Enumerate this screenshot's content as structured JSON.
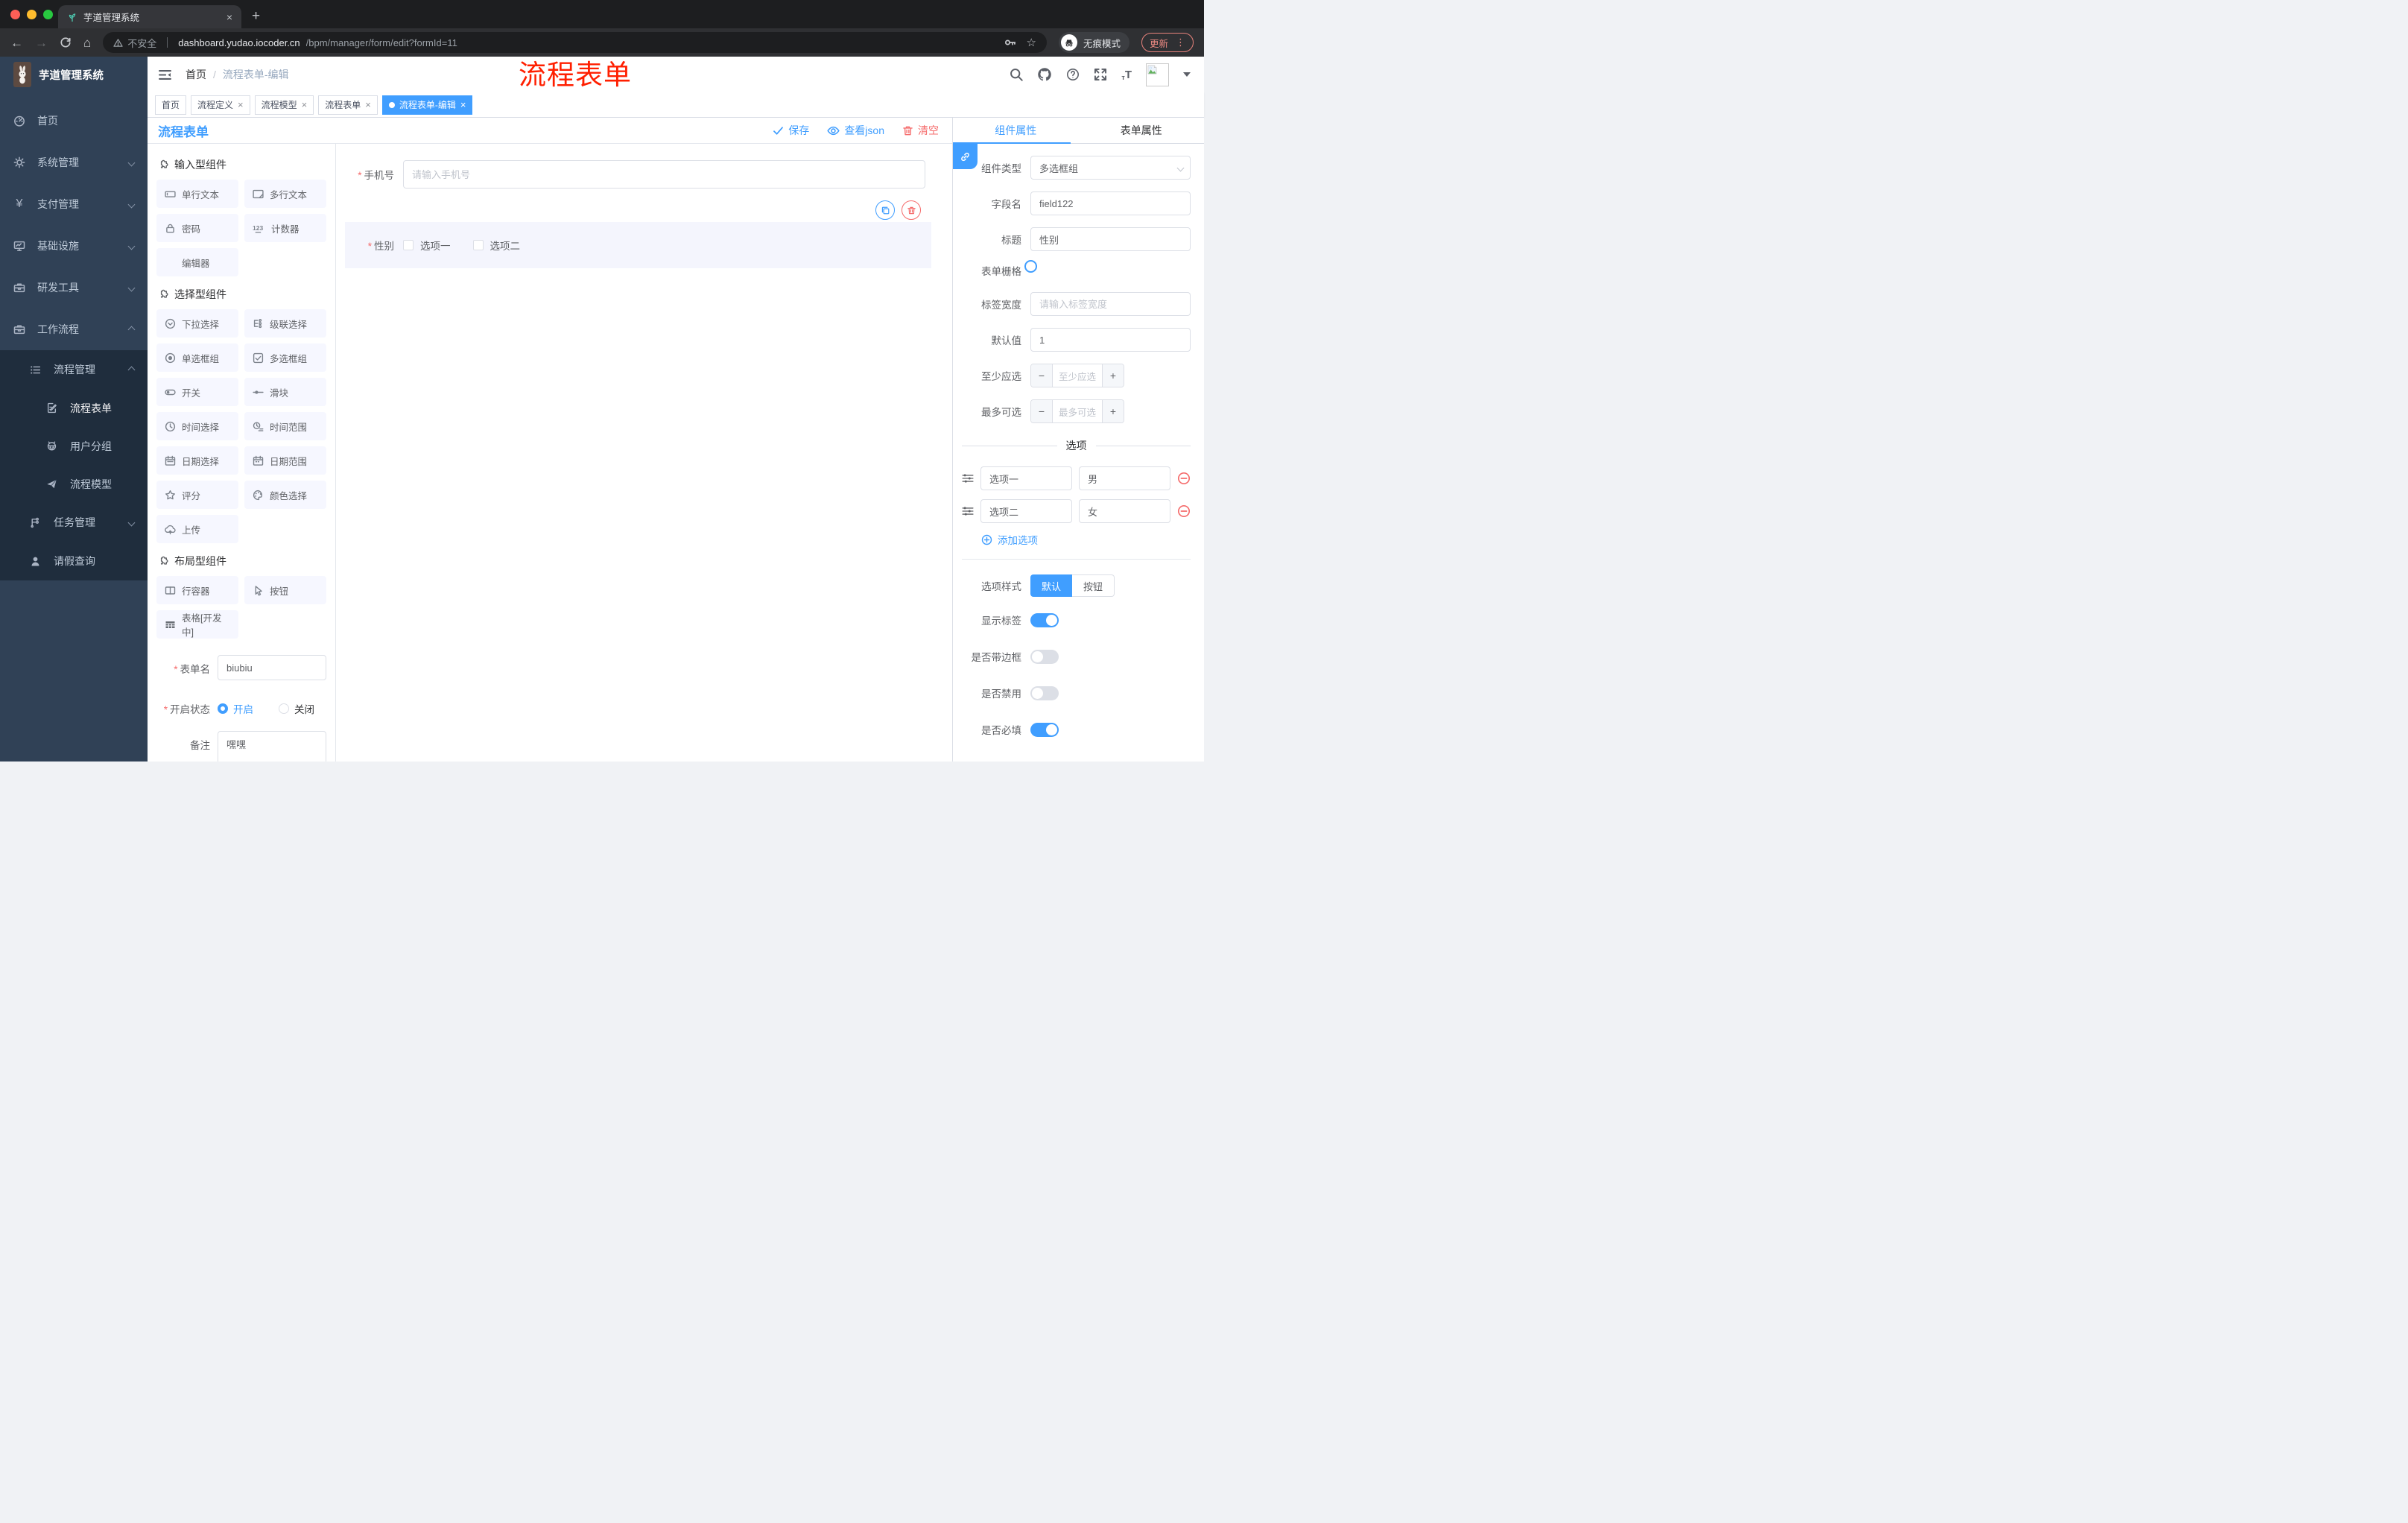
{
  "browser": {
    "tab_title": "芋道管理系统",
    "security": "不安全",
    "host": "dashboard.yudao.iocoder.cn",
    "path": "/bpm/manager/form/edit?formId=11",
    "incognito": "无痕模式",
    "update": "更新"
  },
  "annotation": "流程表单",
  "header": {
    "logo_title": "芋道管理系统",
    "breadcrumb_home": "首页",
    "breadcrumb_current": "流程表单-编辑"
  },
  "sidebar": {
    "home": "首页",
    "system": "系统管理",
    "payment": "支付管理",
    "infrastructure": "基础设施",
    "devtools": "研发工具",
    "workflow": "工作流程",
    "process_management": "流程管理",
    "process_form": "流程表单",
    "user_group": "用户分组",
    "process_model": "流程模型",
    "task_management": "任务管理",
    "leave_query": "请假查询"
  },
  "tags": {
    "home": "首页",
    "process_def": "流程定义",
    "process_model": "流程模型",
    "process_form": "流程表单",
    "active": "流程表单-编辑"
  },
  "designer": {
    "panel_title": "流程表单",
    "toolbar": {
      "save": "保存",
      "view_json": "查看json",
      "clear": "清空"
    },
    "palette": {
      "sections": [
        {
          "title": "输入型组件",
          "items": [
            "单行文本",
            "多行文本",
            "密码",
            "计数器",
            "编辑器"
          ]
        },
        {
          "title": "选择型组件",
          "items": [
            "下拉选择",
            "级联选择",
            "单选框组",
            "多选框组",
            "开关",
            "滑块",
            "时间选择",
            "时间范围",
            "日期选择",
            "日期范围",
            "评分",
            "颜色选择",
            "上传"
          ]
        },
        {
          "title": "布局型组件",
          "items": [
            "行容器",
            "按钮",
            "表格[开发中]"
          ]
        }
      ]
    },
    "meta": {
      "form_name_label": "表单名",
      "form_name_value": "biubiu",
      "status_label": "开启状态",
      "status_on": "开启",
      "status_off": "关闭",
      "remark_label": "备注",
      "remark_value": "嘿嘿"
    },
    "canvas": {
      "phone_label": "手机号",
      "phone_placeholder": "请输入手机号",
      "gender_label": "性别",
      "gender_options": [
        "选项一",
        "选项二"
      ]
    },
    "props": {
      "tab_component": "组件属性",
      "tab_form": "表单属性",
      "component_type_label": "组件类型",
      "component_type_value": "多选框组",
      "field_name_label": "字段名",
      "field_name_value": "field122",
      "title_label": "标题",
      "title_value": "性别",
      "grid_label": "表单栅格",
      "label_width_label": "标签宽度",
      "label_width_placeholder": "请输入标签宽度",
      "default_label": "默认值",
      "default_value": "1",
      "min_label": "至少应选",
      "min_placeholder": "至少应选",
      "max_label": "最多可选",
      "max_placeholder": "最多可选",
      "options_title": "选项",
      "options": [
        {
          "label": "选项一",
          "value": "男"
        },
        {
          "label": "选项二",
          "value": "女"
        }
      ],
      "add_option": "添加选项",
      "style_label": "选项样式",
      "style_default": "默认",
      "style_button": "按钮",
      "switch_show_label": "显示标签",
      "switch_border": "是否带边框",
      "switch_disabled": "是否禁用",
      "switch_required": "是否必填"
    },
    "colors": {
      "accent": "#409eff",
      "danger": "#f56c6c",
      "sidebar": "#304156",
      "annotation": "#ff1f00"
    }
  }
}
